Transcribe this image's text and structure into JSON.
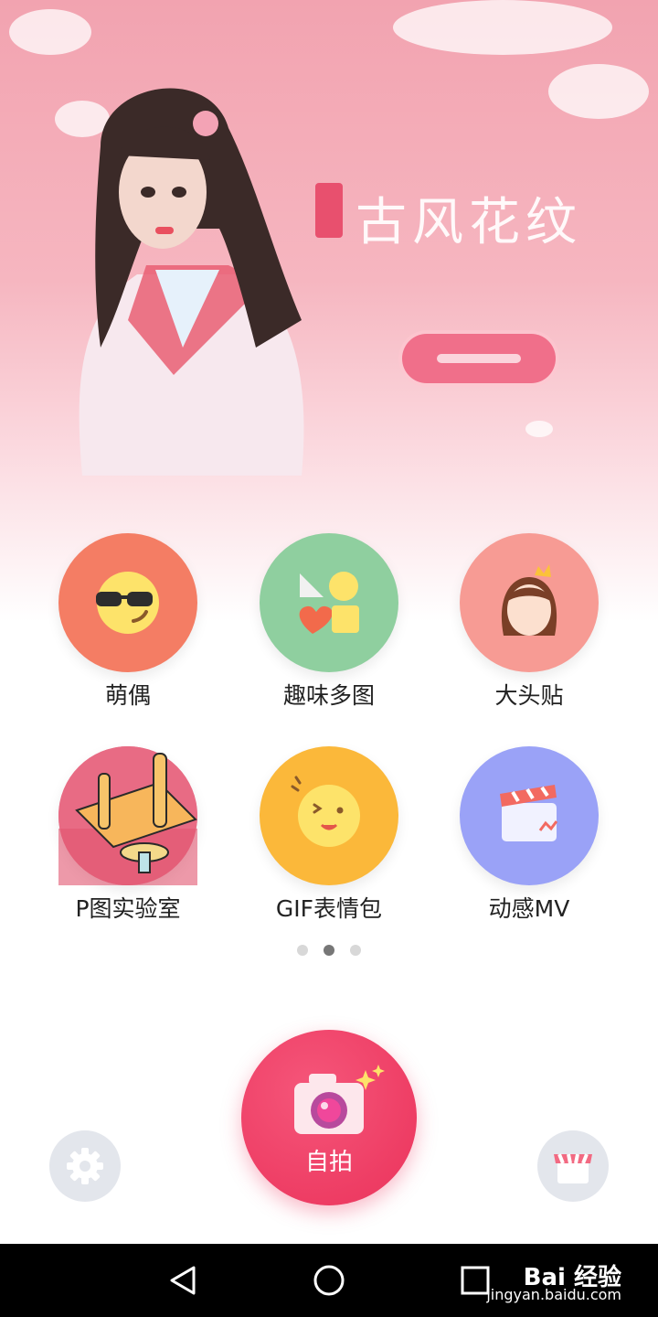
{
  "banner": {
    "title_glyphs": "古风花纹"
  },
  "features": [
    {
      "label": "萌偶",
      "icon": "sunglasses-emoji-icon",
      "color": "#f47d64"
    },
    {
      "label": "趣味多图",
      "icon": "shapes-icon",
      "color": "#8fcf9f"
    },
    {
      "label": "大头贴",
      "icon": "princess-face-icon",
      "color": "#f79b94"
    },
    {
      "label": "P图实验室",
      "icon": "sketch-lab-icon",
      "color": "#e66c83"
    },
    {
      "label": "GIF表情包",
      "icon": "smiley-icon",
      "color": "#fbb83a"
    },
    {
      "label": "动感MV",
      "icon": "clapperboard-icon",
      "color": "#9aa2f7"
    }
  ],
  "pagination": {
    "total": 3,
    "active_index": 1
  },
  "selfie": {
    "label": "自拍"
  },
  "watermark": {
    "brand": "Bai 经验",
    "site": "jingyan.baidu.com"
  }
}
